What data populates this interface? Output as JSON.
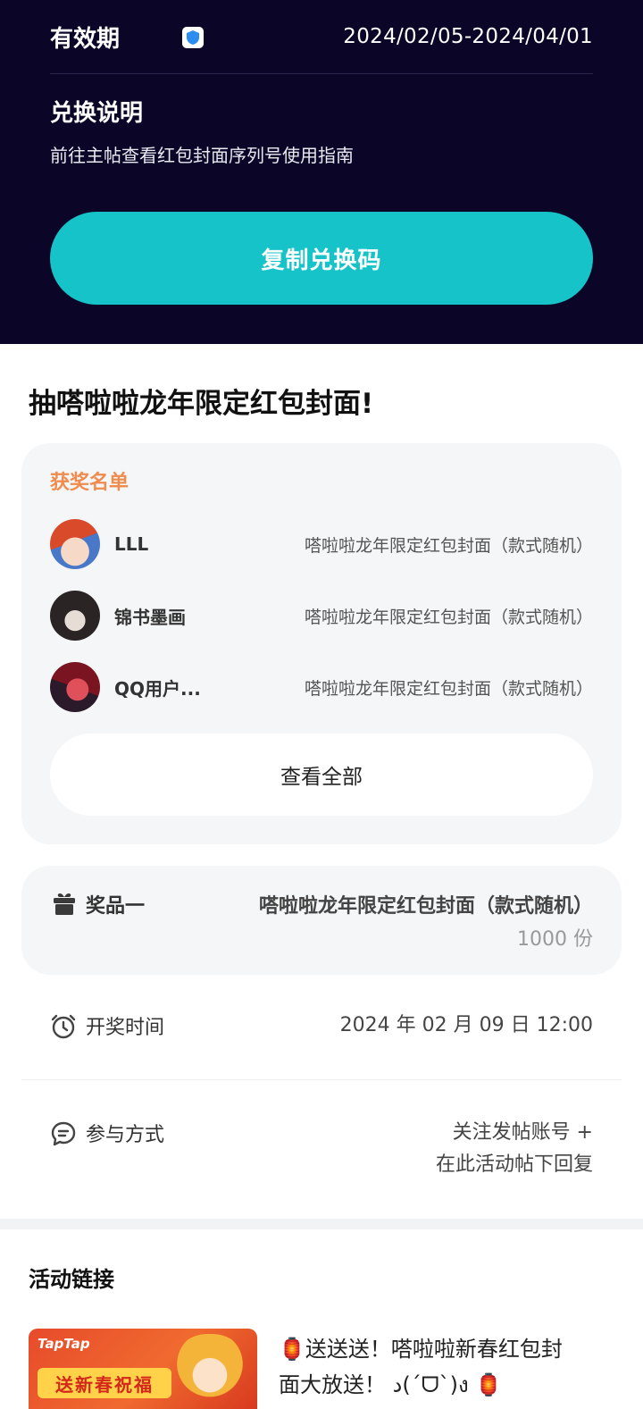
{
  "redeem": {
    "validity_label": "有效期",
    "validity_value": "2024/02/05-2024/04/01",
    "title": "兑换说明",
    "description": "前往主帖查看红包封面序列号使用指南",
    "copy_button": "复制兑换码"
  },
  "lottery": {
    "title": "抽嗒啦啦龙年限定红包封面!",
    "winners_heading": "获奖名单",
    "winners": [
      {
        "name": "LLL",
        "prize": "嗒啦啦龙年限定红包封面（款式随机）"
      },
      {
        "name": "锦书墨画",
        "prize": "嗒啦啦龙年限定红包封面（款式随机）"
      },
      {
        "name": "QQ用户...",
        "prize": "嗒啦啦龙年限定红包封面（款式随机）"
      }
    ],
    "view_all": "查看全部",
    "prize": {
      "label": "奖品一",
      "name": "嗒啦啦龙年限定红包封面（款式随机）",
      "count": "1000 份"
    },
    "draw_time": {
      "label": "开奖时间",
      "value": "2024 年 02 月 09 日 12:00"
    },
    "participation": {
      "label": "参与方式",
      "line1": "关注发帖账号 +",
      "line2": "在此活动帖下回复"
    }
  },
  "links": {
    "title": "活动链接",
    "thumb_brand": "TapTap",
    "thumb_banner": "送新春祝福",
    "item_line1": "🏮送送送！嗒啦啦新春红包封",
    "item_line2": "面大放送！ د(´ᗜ`)ง 🏮"
  },
  "colors": {
    "accent": "#16c3c9",
    "dark_bg": "#0b0628",
    "orange": "#f08b4e"
  }
}
